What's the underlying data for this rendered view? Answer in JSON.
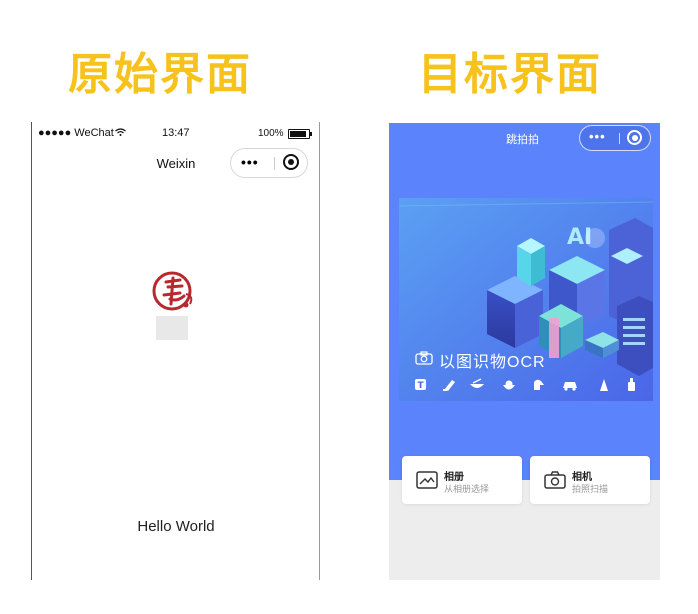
{
  "headings": {
    "left": "原始界面",
    "right": "目标界面"
  },
  "left_phone": {
    "status": {
      "carrier": "●●●●● WeChat",
      "time": "13:47",
      "battery": "100%"
    },
    "nav_title": "Weixin",
    "hello_text": "Hello World"
  },
  "right_phone": {
    "nav_title": "跳拍拍",
    "banner_caption": "以图识物OCR",
    "banner_icons": [
      "text-icon",
      "edit-icon",
      "food-icon",
      "flower-icon",
      "animal-icon",
      "car-icon",
      "landmark-icon",
      "wine-icon"
    ],
    "cards": [
      {
        "title": "相册",
        "subtitle": "从相册选择",
        "icon": "album-icon"
      },
      {
        "title": "相机",
        "subtitle": "拍照扫描",
        "icon": "camera-icon"
      }
    ]
  },
  "colors": {
    "heading": "#f7c21c",
    "primary_blue": "#5b83fb",
    "page_bg": "#ededed"
  }
}
